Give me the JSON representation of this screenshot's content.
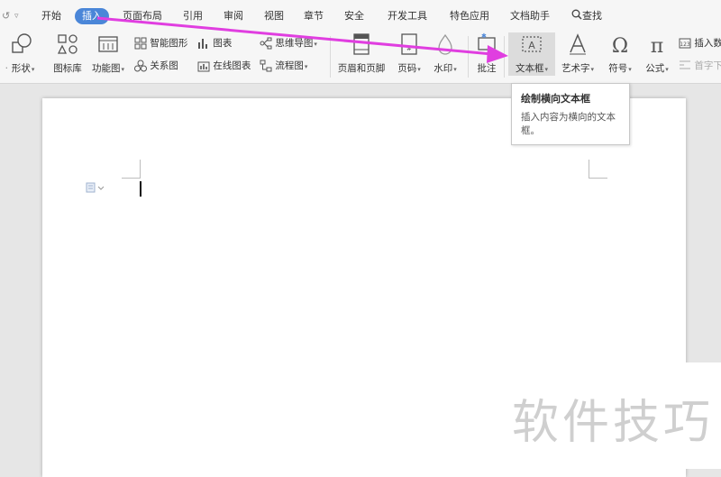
{
  "menubar": {
    "items": [
      "开始",
      "插入",
      "页面布局",
      "引用",
      "审阅",
      "视图",
      "章节",
      "安全",
      "开发工具",
      "特色应用",
      "文档助手"
    ],
    "active_index": 1,
    "search_label": "查找"
  },
  "ribbon": {
    "shape_label": "形状",
    "icon_lib_label": "图标库",
    "func_chart_label": "功能图",
    "smart_shape_label": "智能图形",
    "chart_label": "图表",
    "mind_map_label": "思维导图",
    "relation_label": "关系图",
    "online_chart_label": "在线图表",
    "flowchart_label": "流程图",
    "header_footer_label": "页眉和页脚",
    "page_num_label": "页码",
    "watermark_label": "水印",
    "comment_label": "批注",
    "textbox_label": "文本框",
    "wordart_label": "艺术字",
    "symbol_label": "符号",
    "formula_label": "公式",
    "insert_num_label": "插入数",
    "dropcap_label": "首字下"
  },
  "tooltip": {
    "title": "绘制横向文本框",
    "description": "插入内容为横向的文本框。"
  },
  "watermark_text": "软件技巧",
  "colors": {
    "accent": "#4a86d8",
    "arrow": "#e03ee0"
  }
}
